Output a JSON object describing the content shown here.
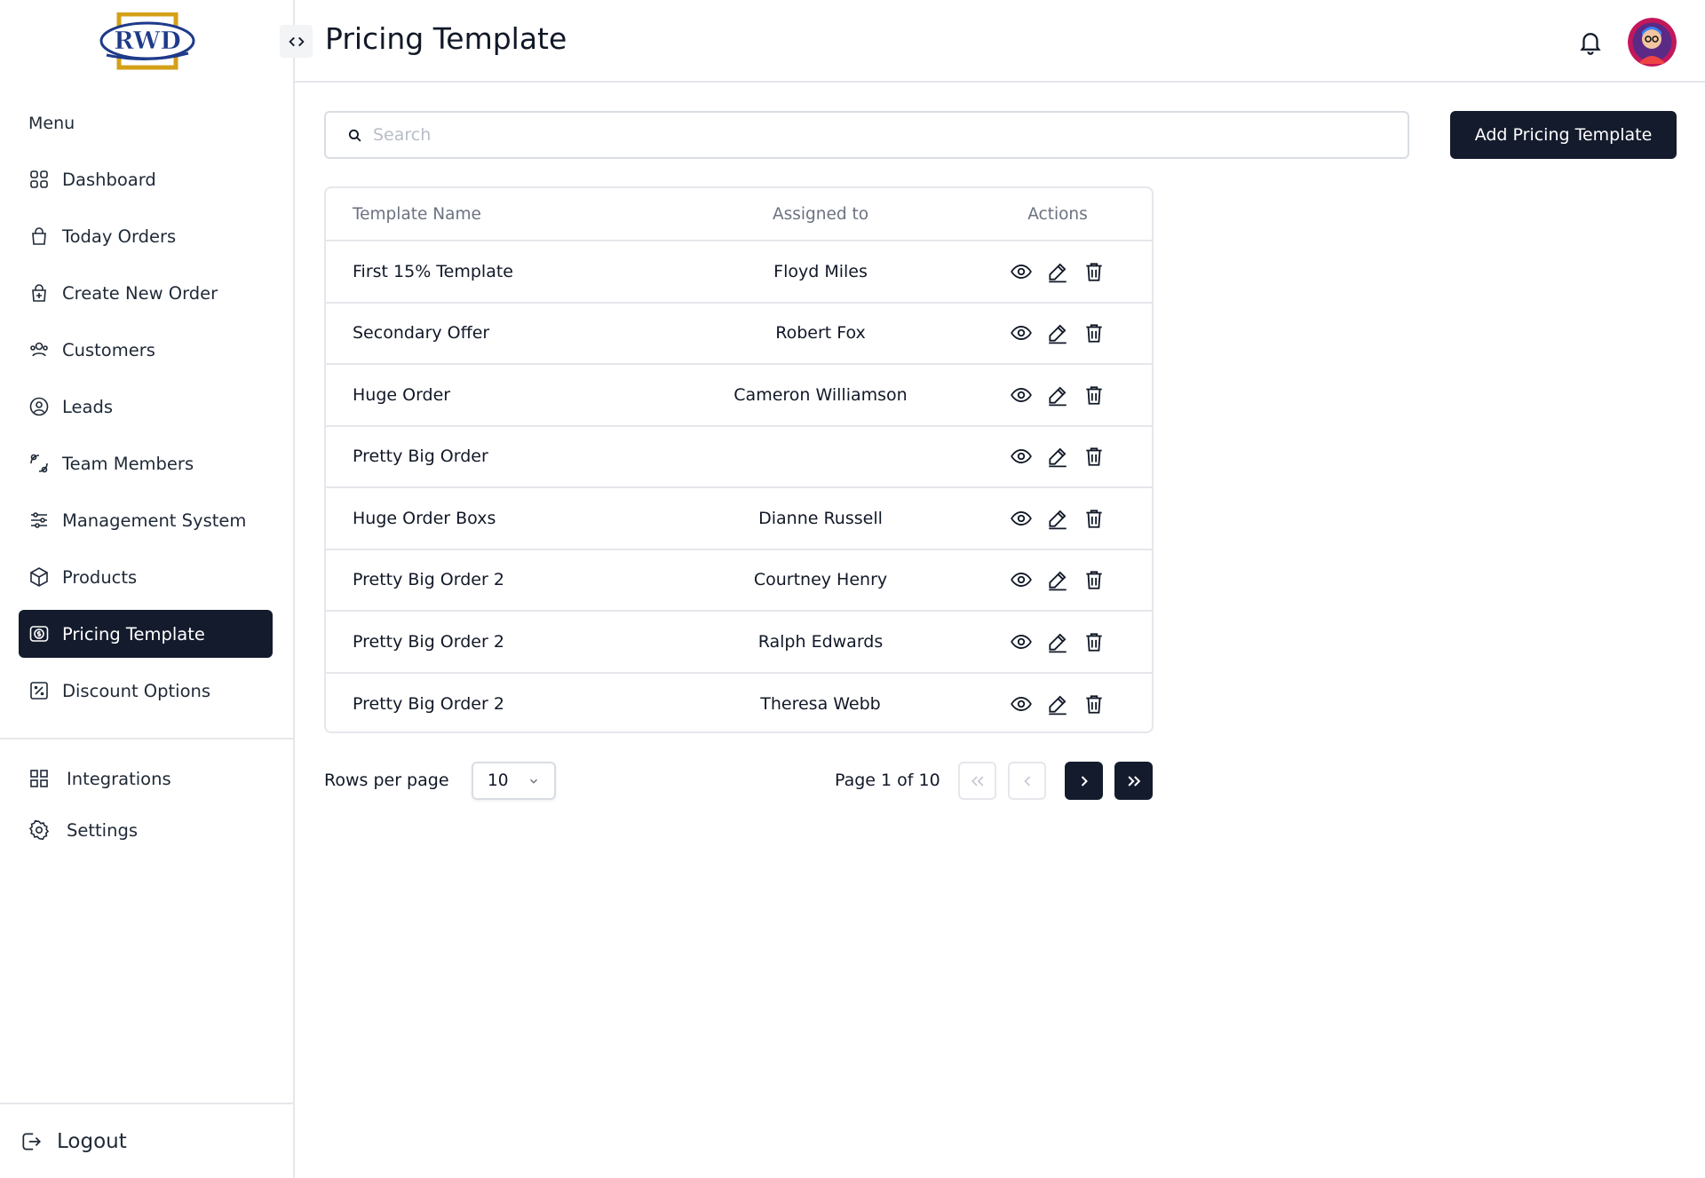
{
  "app": {
    "logo_text": "RWD"
  },
  "header": {
    "title": "Pricing Template"
  },
  "sidebar": {
    "menu_heading": "Menu",
    "items": [
      {
        "label": "Dashboard",
        "icon": "dashboard-icon"
      },
      {
        "label": "Today Orders",
        "icon": "shopping-bag-icon"
      },
      {
        "label": "Create New Order",
        "icon": "add-bag-icon"
      },
      {
        "label": "Customers",
        "icon": "customers-icon"
      },
      {
        "label": "Leads",
        "icon": "user-circle-icon"
      },
      {
        "label": "Team Members",
        "icon": "team-icon"
      },
      {
        "label": "Management System",
        "icon": "sliders-icon"
      },
      {
        "label": "Products",
        "icon": "box-icon"
      },
      {
        "label": "Pricing Template",
        "icon": "dollar-icon",
        "active": true
      },
      {
        "label": "Discount Options",
        "icon": "percent-icon"
      }
    ],
    "secondary": [
      {
        "label": "Integrations",
        "icon": "grid-icon"
      },
      {
        "label": "Settings",
        "icon": "gear-icon"
      }
    ],
    "logout_label": "Logout"
  },
  "search": {
    "placeholder": "Search",
    "value": ""
  },
  "toolbar": {
    "add_label": "Add Pricing Template"
  },
  "table": {
    "columns": [
      "Template Name",
      "Assigned to",
      "Actions"
    ],
    "rows": [
      {
        "name": "First 15% Template",
        "assigned": "Floyd Miles"
      },
      {
        "name": "Secondary Offer",
        "assigned": "Robert Fox"
      },
      {
        "name": "Huge Order",
        "assigned": "Cameron Williamson"
      },
      {
        "name": "Pretty Big Order",
        "assigned": ""
      },
      {
        "name": "Huge Order Boxs",
        "assigned": "Dianne Russell"
      },
      {
        "name": "Pretty Big Order 2",
        "assigned": "Courtney Henry"
      },
      {
        "name": "Pretty Big Order 2",
        "assigned": "Ralph Edwards"
      },
      {
        "name": "Pretty Big Order 2",
        "assigned": "Theresa Webb"
      }
    ]
  },
  "pagination": {
    "rows_label": "Rows per page",
    "rows_value": "10",
    "page_info": "Page 1 of 10"
  },
  "colors": {
    "primary": "#141b2d",
    "border": "#e5e7eb",
    "muted": "#6b7280",
    "logo_blue": "#1e3a8a",
    "logo_gold": "#d4a017"
  }
}
